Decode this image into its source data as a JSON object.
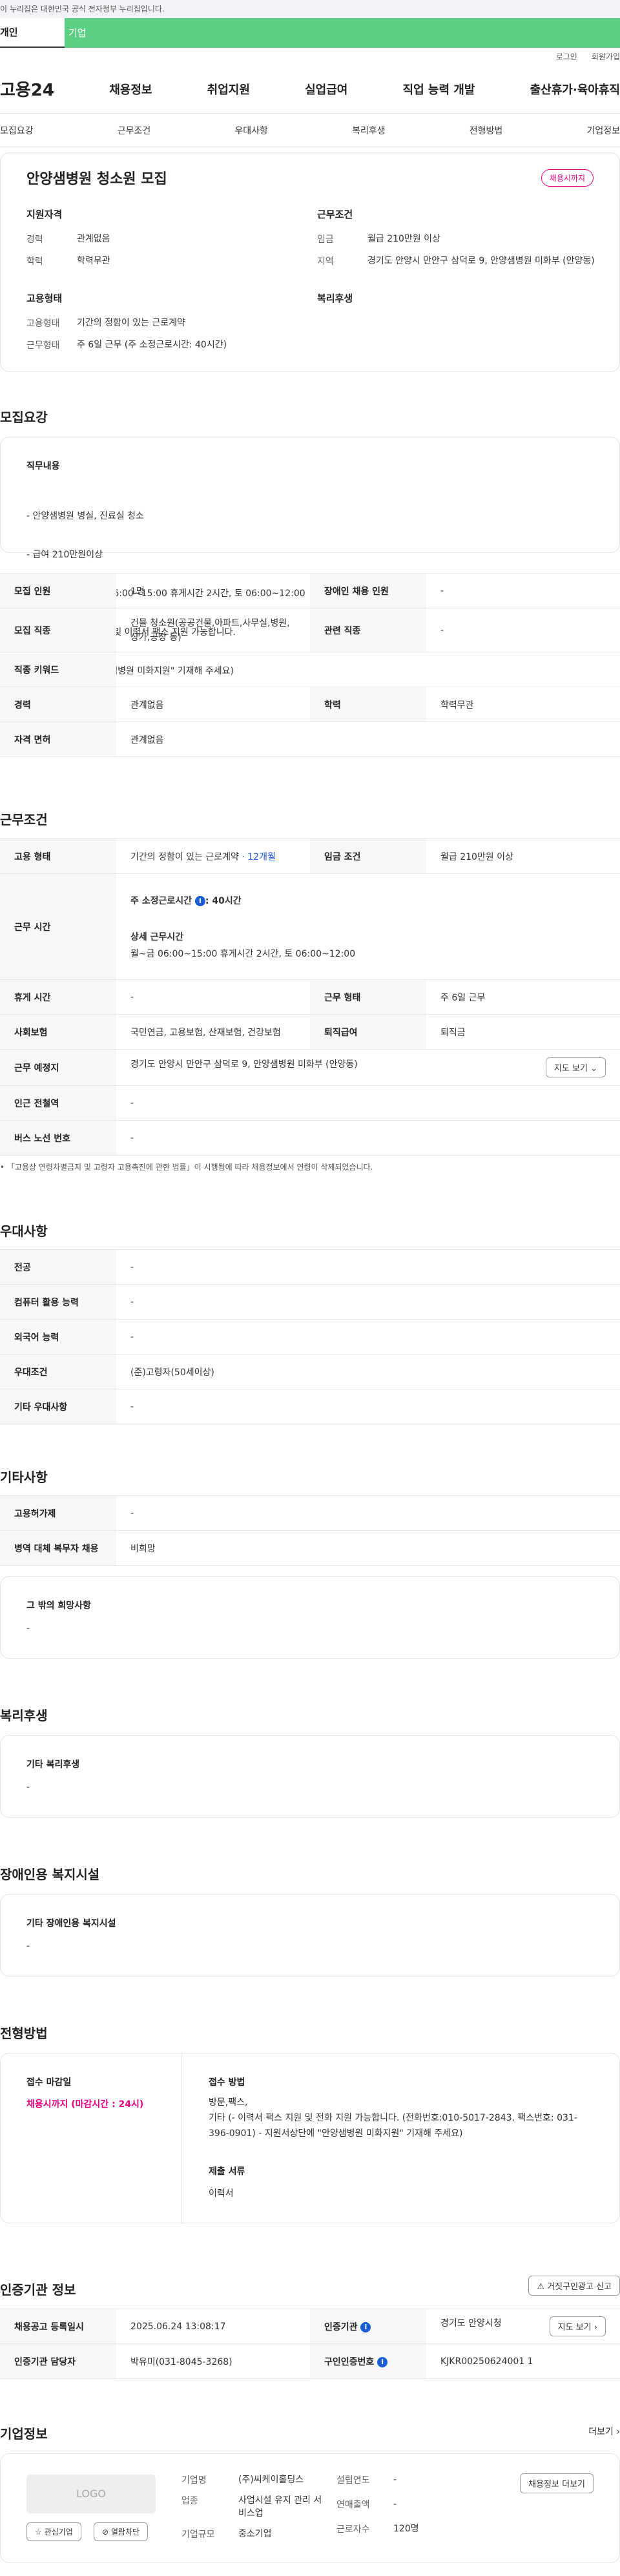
{
  "gov_notice": "이 누리집은 대한민국 공식 전자정부 누리집입니다.",
  "top_tabs": [
    "개인",
    "기업"
  ],
  "util_links": [
    "로그인",
    "회원가입"
  ],
  "logo": "고용24",
  "gnb": [
    "채용정보",
    "취업지원",
    "실업급여",
    "직업 능력 개발",
    "출산휴가·육아휴직"
  ],
  "anchors": [
    "모집요강",
    "근무조건",
    "우대사항",
    "복리후생",
    "전형방법",
    "기업정보"
  ],
  "summary": {
    "title": "안양샘병원 청소원 모집",
    "badge": "채용시까지",
    "qual_title": "지원자격",
    "qual": [
      {
        "k": "경력",
        "v": "관계없음"
      },
      {
        "k": "학력",
        "v": "학력무관"
      }
    ],
    "work_title": "근무조건",
    "work": [
      {
        "k": "임금",
        "v": "월급 210만원 이상"
      },
      {
        "k": "지역",
        "v": "경기도 안양시 만안구 삼덕로 9, 안양샘병원 미화부 (안양동)"
      }
    ],
    "emp_title": "고용형태",
    "emp": [
      {
        "k": "고용형태",
        "v": "기간의 정함이 있는 근로계약"
      },
      {
        "k": "근무형태",
        "v": "주 6일 근무 (주 소정근로시간: 40시간)"
      }
    ],
    "welfare_title": "복리후생"
  },
  "recruit": {
    "title": "모집요강",
    "duty_label": "직무내용",
    "duty_lines": [
      "- 안양샘병원 병실, 진료실 청소",
      "- 급여 210만원이상",
      "- 주6일 근무: 월~금 06:00~15:00 휴게시간 2시간, 토 06:00~12:00",
      "- 채용담당자 유선지원 및 이력서 팩스 지원 가능합니다.",
      "  (지원서상단에 \"안양샘병원 미화지원\" 기재해 주세요)"
    ],
    "rows": {
      "h_count": "모집 인원",
      "count": "1명",
      "h_disabled": "장애인 채용 인원",
      "disabled": "-",
      "h_job": "모집 직종",
      "job": "건물 청소원(공공건물,아파트,사무실,병원,상가,공장 등)",
      "h_related": "관련 직종",
      "related": "-",
      "h_keyword": "직종 키워드",
      "keyword": "-",
      "h_career": "경력",
      "career": "관계없음",
      "h_edu": "학력",
      "edu": "학력무관",
      "h_license": "자격 면허",
      "license": "관계없음"
    }
  },
  "conditions": {
    "title": "근무조건",
    "h_type": "고용 형태",
    "type": "기간의 정함이 있는 근로계약",
    "type_months": "· 12개월",
    "h_wage": "임금 조건",
    "wage": "월급 210만원 이상",
    "h_hours": "근무 시간",
    "hours_label": "주 소정근로시간",
    "hours_val": ": 40시간",
    "detail_label": "상세 근무시간",
    "detail": "월~금 06:00~15:00 휴게시간 2시간, 토 06:00~12:00",
    "h_break": "휴게 시간",
    "break": "-",
    "h_shape": "근무 형태",
    "shape": "주 6일 근무",
    "h_ins": "사회보험",
    "ins": "국민연금, 고용보험, 산재보험, 건강보험",
    "h_ret": "퇴직급여",
    "ret": "퇴직금",
    "h_place": "근무 예정지",
    "place": "경기도 안양시 만안구 삼덕로 9, 안양샘병원 미화부 (안양동)",
    "map_btn": "지도 보기",
    "h_subway": "인근 전철역",
    "subway": "-",
    "h_bus": "버스 노선 번호",
    "bus": "-",
    "note": "「고용상 연령차별금지 및 고령자 고용촉진에 관한 법률」이 시행됨에 따라 채용정보에서 연령이 삭제되었습니다."
  },
  "pref": {
    "title": "우대사항",
    "h_major": "전공",
    "major": "-",
    "h_pc": "컴퓨터 활용 능력",
    "pc": "-",
    "h_lang": "외국어 능력",
    "lang": "-",
    "h_cond": "우대조건",
    "cond": "(준)고령자(50세이상)",
    "h_etc": "기타 우대사항",
    "etc": "-"
  },
  "other": {
    "title": "기타사항",
    "h_emp": "고용허가제",
    "emp": "-",
    "h_mil": "병역 대체 복무자 채용",
    "mil": "비희망",
    "etc_label": "그 밖의 희망사항",
    "etc_val": "-"
  },
  "welfare": {
    "title": "복리후생",
    "label": "기타 복리후생",
    "val": "-"
  },
  "facility": {
    "title": "장애인용 복지시설",
    "label": "기타 장애인용 복지시설",
    "val": "-"
  },
  "process": {
    "title": "전형방법",
    "deadline_label": "접수 마감일",
    "deadline": "채용시까지 (마감시간 : 24시)",
    "method_label": "접수 방법",
    "method1": "방문,팩스,",
    "method2": "기타 (- 이력서 팩스 지원 및 전화 지원 가능합니다. (전화번호:010-5017-2843, 팩스번호: 031-396-0901) - 지원서상단에 \"안양샘병원 미화지원\" 기재해 주세요)",
    "docs_label": "제출 서류",
    "docs": "이력서"
  },
  "agency": {
    "title": "인증기관 정보",
    "report_btn": "거짓구인광고 신고",
    "h_date": "채용공고 등록일시",
    "date": "2025.06.24 13:08:17",
    "h_org": "인증기관",
    "org": "경기도 안양시청",
    "map_btn": "지도 보기",
    "h_mgr": "인증기관 담당자",
    "mgr": "박유미(031-8045-3268)",
    "h_no": "구인인증번호",
    "no": "KJKR00250624001 1"
  },
  "company": {
    "title": "기업정보",
    "more": "더보기",
    "logo": "LOGO",
    "fav": "관심기업",
    "block": "열람차단",
    "h_name": "기업명",
    "name": "(주)씨케이홀딩스",
    "h_biz": "업종",
    "biz": "사업시설 유지 관리 서비스업",
    "h_size": "기업규모",
    "size": "중소기업",
    "h_year": "설립연도",
    "year": "-",
    "h_sales": "연매출액",
    "sales": "-",
    "h_emp": "근로자수",
    "emp": "120명",
    "jobs_btn": "채용정보 더보기"
  }
}
